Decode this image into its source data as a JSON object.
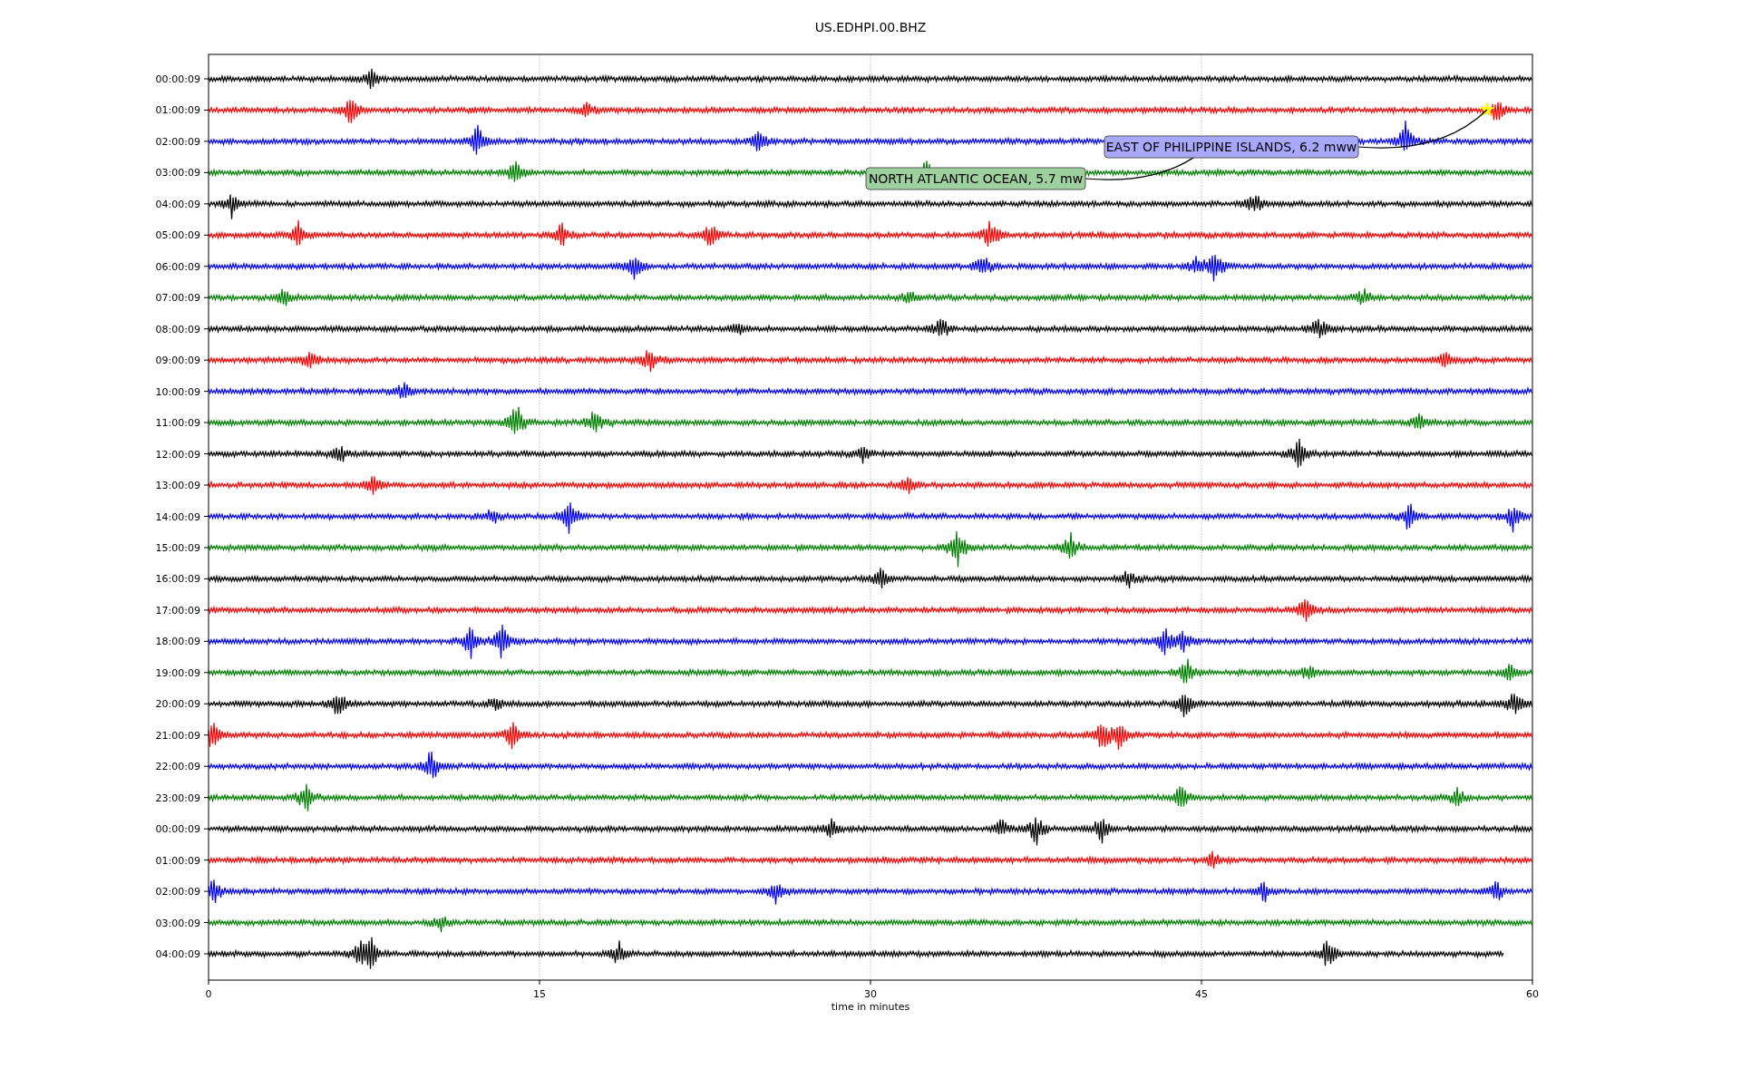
{
  "title": "US.EDHPI.00.BHZ",
  "xlabel": "time in minutes",
  "xticks": [
    "0",
    "15",
    "30",
    "45",
    "60"
  ],
  "traces": [
    {
      "label": "00:00:09",
      "color": "#000000"
    },
    {
      "label": "01:00:09",
      "color": "#ff0000"
    },
    {
      "label": "02:00:09",
      "color": "#0000ff"
    },
    {
      "label": "03:00:09",
      "color": "#008000"
    },
    {
      "label": "04:00:09",
      "color": "#000000"
    },
    {
      "label": "05:00:09",
      "color": "#ff0000"
    },
    {
      "label": "06:00:09",
      "color": "#0000ff"
    },
    {
      "label": "07:00:09",
      "color": "#008000"
    },
    {
      "label": "08:00:09",
      "color": "#000000"
    },
    {
      "label": "09:00:09",
      "color": "#ff0000"
    },
    {
      "label": "10:00:09",
      "color": "#0000ff"
    },
    {
      "label": "11:00:09",
      "color": "#008000"
    },
    {
      "label": "12:00:09",
      "color": "#000000"
    },
    {
      "label": "13:00:09",
      "color": "#ff0000"
    },
    {
      "label": "14:00:09",
      "color": "#0000ff"
    },
    {
      "label": "15:00:09",
      "color": "#008000"
    },
    {
      "label": "16:00:09",
      "color": "#000000"
    },
    {
      "label": "17:00:09",
      "color": "#ff0000"
    },
    {
      "label": "18:00:09",
      "color": "#0000ff"
    },
    {
      "label": "19:00:09",
      "color": "#008000"
    },
    {
      "label": "20:00:09",
      "color": "#000000"
    },
    {
      "label": "21:00:09",
      "color": "#ff0000"
    },
    {
      "label": "22:00:09",
      "color": "#0000ff"
    },
    {
      "label": "23:00:09",
      "color": "#008000"
    },
    {
      "label": "00:00:09",
      "color": "#000000"
    },
    {
      "label": "01:00:09",
      "color": "#ff0000"
    },
    {
      "label": "02:00:09",
      "color": "#0000ff"
    },
    {
      "label": "03:00:09",
      "color": "#008000"
    },
    {
      "label": "04:00:09",
      "color": "#000000"
    }
  ],
  "events": [
    {
      "text": "EAST OF PHILIPPINE ISLANDS, 6.2 mww",
      "color": "#a8a8ff"
    },
    {
      "text": "NORTH ATLANTIC OCEAN, 5.7 mw",
      "color": "#9fd09f"
    }
  ]
}
